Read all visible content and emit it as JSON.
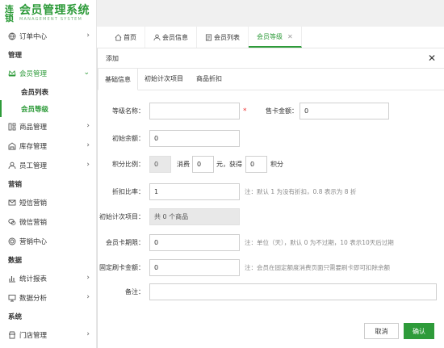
{
  "app": {
    "logo_mark": "连锁",
    "logo_title": "会员管理系统",
    "logo_sub": "MANAGEMENT SYSTEM"
  },
  "sidebar": {
    "order_center": "订单中心",
    "section_manage": "管理",
    "member_manage": "会员管理",
    "member_list": "会员列表",
    "member_level": "会员等级",
    "goods_manage": "商品管理",
    "stock_manage": "库存管理",
    "staff_manage": "员工管理",
    "section_marketing": "营销",
    "sms_marketing": "短信营销",
    "wechat_marketing": "微信营销",
    "marketing_center": "营销中心",
    "section_data": "数据",
    "stats_report": "统计报表",
    "data_analysis": "数据分析",
    "section_system": "系统",
    "store_manage": "门店管理"
  },
  "tabs": {
    "home": "首页",
    "member_info": "会员信息",
    "member_list": "会员列表",
    "member_level": "会员等级",
    "close": "✕"
  },
  "modal": {
    "title": "添加",
    "close": "✕",
    "tabs": [
      "基础信息",
      "初始计次项目",
      "商品折扣"
    ],
    "level_name_label": "等级名称：",
    "level_name_value": "",
    "required_mark": "*",
    "card_price_label": "售卡金额：",
    "card_price_value": "0",
    "init_balance_label": "初始余额：",
    "init_balance_value": "0",
    "points_ratio_label": "积分比例：",
    "points_ratio_value": "0",
    "consume_text": "消费",
    "consume_value": "0",
    "yuan_get_text": "元，获得",
    "points_value": "0",
    "points_text": "积分",
    "discount_label": "折扣比率：",
    "discount_value": "1",
    "discount_note": "注：默认 1 为没有折扣，0.8 表示为 8 折",
    "init_items_label": "初始计次项目：",
    "init_items_value": "共 0 个商品",
    "card_period_label": "会员卡期限：",
    "card_period_value": "0",
    "card_period_note": "注：单位（天），默认 0 为不过期，10 表示10天后过期",
    "fixed_amount_label": "固定刷卡金额：",
    "fixed_amount_value": "0",
    "fixed_amount_note": "注：会员在固定额度消费页面只需要刷卡即可扣除余额",
    "remark_label": "备注：",
    "remark_value": "",
    "cancel_button": "取消",
    "confirm_button": "确认"
  },
  "colors": {
    "accent": "#2e9b3a"
  }
}
